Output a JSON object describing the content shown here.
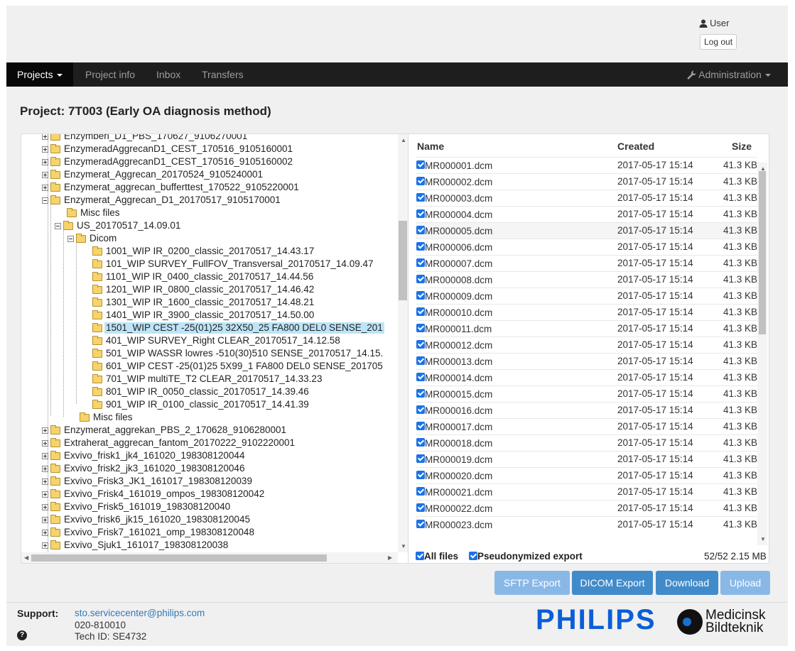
{
  "header": {
    "user_label": "User",
    "logout_label": "Log out"
  },
  "nav": {
    "projects": "Projects",
    "project_info": "Project info",
    "inbox": "Inbox",
    "transfers": "Transfers",
    "administration": "Administration"
  },
  "project_title": "Project: 7T003 (Early OA diagnosis method)",
  "tree": {
    "items": [
      {
        "label": "Enzymberi_D1_PBS_170627_9106270001",
        "depth": 0,
        "exp": "plus"
      },
      {
        "label": "EnzymeradAggrecanD1_CEST_170516_9105160001",
        "depth": 0,
        "exp": "plus"
      },
      {
        "label": "EnzymeradAggrecanD1_CEST_170516_9105160002",
        "depth": 0,
        "exp": "plus"
      },
      {
        "label": "Enzymerat_Aggrecan_20170524_9105240001",
        "depth": 0,
        "exp": "plus"
      },
      {
        "label": "Enzymerat_aggrecan_bufferttest_170522_9105220001",
        "depth": 0,
        "exp": "plus"
      },
      {
        "label": "Enzymerat_Aggrecan_D1_20170517_9105170001",
        "depth": 0,
        "exp": "minus"
      },
      {
        "label": "Misc files",
        "depth": 1,
        "exp": ""
      },
      {
        "label": "US_20170517_14.09.01",
        "depth": 1,
        "exp": "minus"
      },
      {
        "label": "Dicom",
        "depth": 2,
        "exp": "minus"
      },
      {
        "label": "1001_WIP IR_0200_classic_20170517_14.43.17",
        "depth": 3,
        "exp": ""
      },
      {
        "label": "101_WIP SURVEY_FullFOV_Transversal_20170517_14.09.47",
        "depth": 3,
        "exp": ""
      },
      {
        "label": "1101_WIP IR_0400_classic_20170517_14.44.56",
        "depth": 3,
        "exp": ""
      },
      {
        "label": "1201_WIP IR_0800_classic_20170517_14.46.42",
        "depth": 3,
        "exp": ""
      },
      {
        "label": "1301_WIP IR_1600_classic_20170517_14.48.21",
        "depth": 3,
        "exp": ""
      },
      {
        "label": "1401_WIP IR_3900_classic_20170517_14.50.00",
        "depth": 3,
        "exp": ""
      },
      {
        "label": "1501_WIP CEST -25(01)25 32X50_25 FA800 DEL0 SENSE_201",
        "depth": 3,
        "exp": "",
        "selected": true
      },
      {
        "label": "401_WIP SURVEY_Right CLEAR_20170517_14.12.58",
        "depth": 3,
        "exp": ""
      },
      {
        "label": "501_WIP WASSR lowres -510(30)510 SENSE_20170517_14.15.",
        "depth": 3,
        "exp": ""
      },
      {
        "label": "601_WIP CEST -25(01)25 5X99_1 FA800 DEL0 SENSE_201705",
        "depth": 3,
        "exp": ""
      },
      {
        "label": "701_WIP multiTE_T2 CLEAR_20170517_14.33.23",
        "depth": 3,
        "exp": ""
      },
      {
        "label": "801_WIP IR_0050_classic_20170517_14.39.46",
        "depth": 3,
        "exp": ""
      },
      {
        "label": "901_WIP IR_0100_classic_20170517_14.41.39",
        "depth": 3,
        "exp": ""
      },
      {
        "label": "Misc files",
        "depth": 2,
        "exp": ""
      },
      {
        "label": "Enzymerat_aggrekan_PBS_2_170628_9106280001",
        "depth": 0,
        "exp": "plus"
      },
      {
        "label": "Extraherat_aggrecan_fantom_20170222_9102220001",
        "depth": 0,
        "exp": "plus"
      },
      {
        "label": "Exvivo_frisk1_jk4_161020_198308120044",
        "depth": 0,
        "exp": "plus"
      },
      {
        "label": "Exvivo_frisk2_jk3_161020_198308120046",
        "depth": 0,
        "exp": "plus"
      },
      {
        "label": "Exvivo_Frisk3_JK1_161017_198308120039",
        "depth": 0,
        "exp": "plus"
      },
      {
        "label": "Exvivo_Frisk4_161019_ompos_198308120042",
        "depth": 0,
        "exp": "plus"
      },
      {
        "label": "Exvivo_Frisk5_161019_198308120040",
        "depth": 0,
        "exp": "plus"
      },
      {
        "label": "Exvivo_frisk6_jk15_161020_198308120045",
        "depth": 0,
        "exp": "plus"
      },
      {
        "label": "Exvivo_Frisk7_161021_omp_198308120048",
        "depth": 0,
        "exp": "plus"
      },
      {
        "label": "Exvivo_Sjuk1_161017_198308120038",
        "depth": 0,
        "exp": "plus"
      }
    ]
  },
  "files": {
    "headers": {
      "name": "Name",
      "created": "Created",
      "size": "Size"
    },
    "rows": [
      {
        "name": "MR000001.dcm",
        "created": "2017-05-17 15:14",
        "size": "41.3 KB"
      },
      {
        "name": "MR000002.dcm",
        "created": "2017-05-17 15:14",
        "size": "41.3 KB"
      },
      {
        "name": "MR000003.dcm",
        "created": "2017-05-17 15:14",
        "size": "41.3 KB"
      },
      {
        "name": "MR000004.dcm",
        "created": "2017-05-17 15:14",
        "size": "41.3 KB"
      },
      {
        "name": "MR000005.dcm",
        "created": "2017-05-17 15:14",
        "size": "41.3 KB",
        "hover": true
      },
      {
        "name": "MR000006.dcm",
        "created": "2017-05-17 15:14",
        "size": "41.3 KB"
      },
      {
        "name": "MR000007.dcm",
        "created": "2017-05-17 15:14",
        "size": "41.3 KB"
      },
      {
        "name": "MR000008.dcm",
        "created": "2017-05-17 15:14",
        "size": "41.3 KB"
      },
      {
        "name": "MR000009.dcm",
        "created": "2017-05-17 15:14",
        "size": "41.3 KB"
      },
      {
        "name": "MR000010.dcm",
        "created": "2017-05-17 15:14",
        "size": "41.3 KB"
      },
      {
        "name": "MR000011.dcm",
        "created": "2017-05-17 15:14",
        "size": "41.3 KB"
      },
      {
        "name": "MR000012.dcm",
        "created": "2017-05-17 15:14",
        "size": "41.3 KB"
      },
      {
        "name": "MR000013.dcm",
        "created": "2017-05-17 15:14",
        "size": "41.3 KB"
      },
      {
        "name": "MR000014.dcm",
        "created": "2017-05-17 15:14",
        "size": "41.3 KB"
      },
      {
        "name": "MR000015.dcm",
        "created": "2017-05-17 15:14",
        "size": "41.3 KB"
      },
      {
        "name": "MR000016.dcm",
        "created": "2017-05-17 15:14",
        "size": "41.3 KB"
      },
      {
        "name": "MR000017.dcm",
        "created": "2017-05-17 15:14",
        "size": "41.3 KB"
      },
      {
        "name": "MR000018.dcm",
        "created": "2017-05-17 15:14",
        "size": "41.3 KB"
      },
      {
        "name": "MR000019.dcm",
        "created": "2017-05-17 15:14",
        "size": "41.3 KB"
      },
      {
        "name": "MR000020.dcm",
        "created": "2017-05-17 15:14",
        "size": "41.3 KB"
      },
      {
        "name": "MR000021.dcm",
        "created": "2017-05-17 15:14",
        "size": "41.3 KB"
      },
      {
        "name": "MR000022.dcm",
        "created": "2017-05-17 15:14",
        "size": "41.3 KB"
      },
      {
        "name": "MR000023.dcm",
        "created": "2017-05-17 15:14",
        "size": "41.3 KB"
      }
    ],
    "all_files_label": "All files",
    "pseudonymized_label": "Pseudonymized export",
    "summary": "52/52 2.15 MB"
  },
  "buttons": {
    "sftp": "SFTP Export",
    "dicom": "DICOM Export",
    "download": "Download",
    "upload": "Upload"
  },
  "support": {
    "label": "Support:",
    "email": "sto.servicecenter@philips.com",
    "phone": "020-810010",
    "tech_id": "Tech ID: SE4732"
  },
  "logos": {
    "philips": "PHILIPS",
    "mb_line1": "Medicinsk",
    "mb_line2": "Bildteknik"
  }
}
